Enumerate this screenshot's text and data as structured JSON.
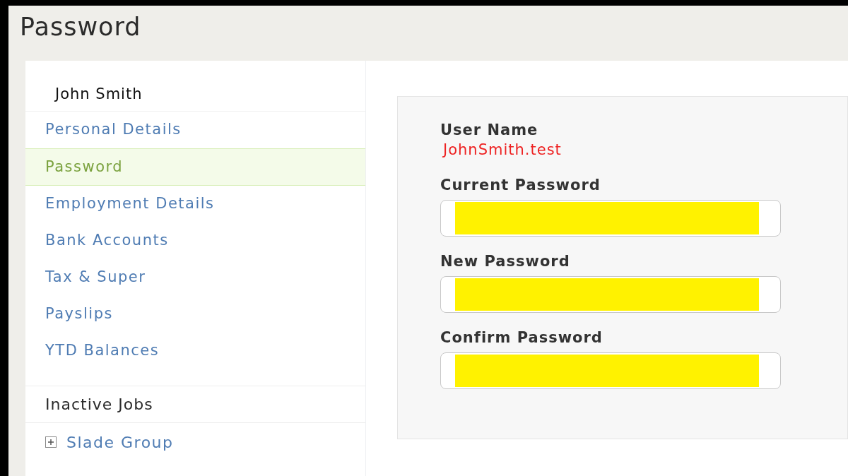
{
  "page_title": "Password",
  "sidebar": {
    "user": "John Smith",
    "items": [
      {
        "label": "Personal Details",
        "selected": false
      },
      {
        "label": "Password",
        "selected": true
      },
      {
        "label": "Employment Details",
        "selected": false
      },
      {
        "label": "Bank Accounts",
        "selected": false
      },
      {
        "label": "Tax & Super",
        "selected": false
      },
      {
        "label": "Payslips",
        "selected": false
      },
      {
        "label": "YTD Balances",
        "selected": false
      }
    ],
    "section": "Inactive Jobs",
    "groups": [
      {
        "label": "Slade Group",
        "expanded": false
      }
    ]
  },
  "form": {
    "user_name_label": "User Name",
    "user_name": "JohnSmith.test",
    "fields": [
      {
        "label": "Current Password",
        "redacted": true
      },
      {
        "label": "New Password",
        "redacted": true
      },
      {
        "label": "Confirm Password",
        "redacted": true
      }
    ]
  }
}
